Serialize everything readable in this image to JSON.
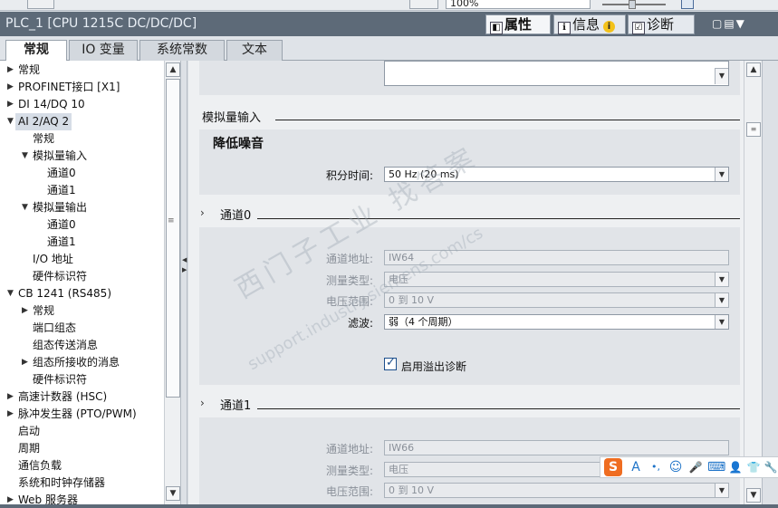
{
  "toolbar": {
    "zoom": "100%"
  },
  "titlebar": {
    "title": "PLC_1 [CPU 1215C DC/DC/DC]",
    "tabs": [
      {
        "label": "属性",
        "icon": "properties-icon"
      },
      {
        "label": "信息",
        "icon": "info-icon"
      },
      {
        "label": "诊断",
        "icon": "diagnostics-icon"
      }
    ],
    "info_badge": "i",
    "window_controls": "▢▤▼"
  },
  "main_tabs": [
    "常规",
    "IO 变量",
    "系统常数",
    "文本"
  ],
  "tree": {
    "items": [
      {
        "label": "常规",
        "arrow": "▶"
      },
      {
        "label": "PROFINET接口 [X1]",
        "arrow": "▶"
      },
      {
        "label": "DI 14/DQ 10",
        "arrow": "▶"
      },
      {
        "label": "AI 2/AQ 2",
        "arrow": "▼"
      },
      {
        "label": "常规",
        "arrow": ""
      },
      {
        "label": "模拟量输入",
        "arrow": "▼"
      },
      {
        "label": "通道0",
        "arrow": ""
      },
      {
        "label": "通道1",
        "arrow": ""
      },
      {
        "label": "模拟量输出",
        "arrow": "▼"
      },
      {
        "label": "通道0",
        "arrow": ""
      },
      {
        "label": "通道1",
        "arrow": ""
      },
      {
        "label": "I/O 地址",
        "arrow": ""
      },
      {
        "label": "硬件标识符",
        "arrow": ""
      },
      {
        "label": "CB 1241 (RS485)",
        "arrow": "▼"
      },
      {
        "label": "常规",
        "arrow": "▶"
      },
      {
        "label": "端口组态",
        "arrow": ""
      },
      {
        "label": "组态传送消息",
        "arrow": ""
      },
      {
        "label": "组态所接收的消息",
        "arrow": "▶"
      },
      {
        "label": "硬件标识符",
        "arrow": ""
      },
      {
        "label": "高速计数器 (HSC)",
        "arrow": "▶"
      },
      {
        "label": "脉冲发生器 (PTO/PWM)",
        "arrow": "▶"
      },
      {
        "label": "启动",
        "arrow": ""
      },
      {
        "label": "周期",
        "arrow": ""
      },
      {
        "label": "通信负载",
        "arrow": ""
      },
      {
        "label": "系统和时钟存储器",
        "arrow": ""
      },
      {
        "label": "Web 服务器",
        "arrow": "▶"
      }
    ]
  },
  "content": {
    "analog_input_title": "模拟量输入",
    "noise_reduction_title": "降低噪音",
    "integration_time_label": "积分时间:",
    "integration_time_value": "50 Hz (20 ms)",
    "channel0": {
      "title": "通道0",
      "address_label": "通道地址:",
      "address_value": "IW64",
      "meas_type_label": "测量类型:",
      "meas_type_value": "电压",
      "voltage_range_label": "电压范围:",
      "voltage_range_value": "0 到 10 V",
      "filter_label": "滤波:",
      "filter_value": "弱（4 个周期）",
      "overflow_diag_label": "启用溢出诊断",
      "overflow_diag_checked": true
    },
    "channel1": {
      "title": "通道1",
      "address_label": "通道地址:",
      "address_value": "IW66",
      "meas_type_label": "测量类型:",
      "meas_type_value": "电压",
      "voltage_range_label": "电压范围:",
      "voltage_range_value": "0 到 10 V"
    }
  },
  "watermark": {
    "line1": "西门子工业 找答案",
    "line2": "support.industry.siemens.com/cs"
  },
  "ime": {
    "logo": "S",
    "items": [
      "A",
      "•,",
      "☺",
      "🎤",
      "⌨",
      "👤",
      "👕",
      "🔧"
    ]
  }
}
